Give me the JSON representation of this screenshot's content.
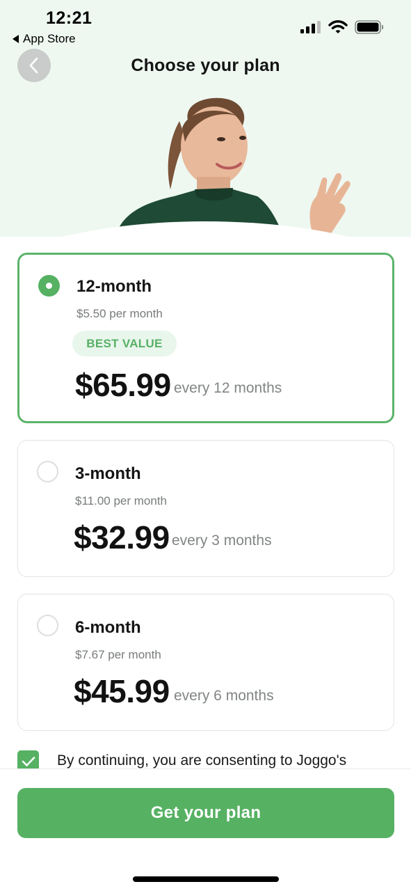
{
  "status_bar": {
    "time": "12:21",
    "back_app": "App Store",
    "icons": [
      "cellular-signal-icon",
      "wifi-icon",
      "battery-icon"
    ]
  },
  "nav": {
    "back_icon": "chevron-left-icon",
    "title": "Choose your plan"
  },
  "hero": {
    "image": "woman-waving-photo"
  },
  "plans": [
    {
      "name": "12-month",
      "per_month": "$5.50 per month",
      "badge": "BEST VALUE",
      "price": "$65.99",
      "period": "every 12 months",
      "selected": true
    },
    {
      "name": "3-month",
      "per_month": "$11.00 per month",
      "price": "$32.99",
      "period": "every 3 months",
      "selected": false
    },
    {
      "name": "6-month",
      "per_month": "$7.67 per month",
      "price": "$45.99",
      "period": "every 6 months",
      "selected": false
    }
  ],
  "consent": {
    "checked": true,
    "text": "By continuing, you are consenting to Joggo's"
  },
  "cta": {
    "label": "Get your plan"
  },
  "colors": {
    "accent": "#56b163",
    "hero_background": "#eef8f1",
    "badge_background": "#e8f6ec"
  }
}
